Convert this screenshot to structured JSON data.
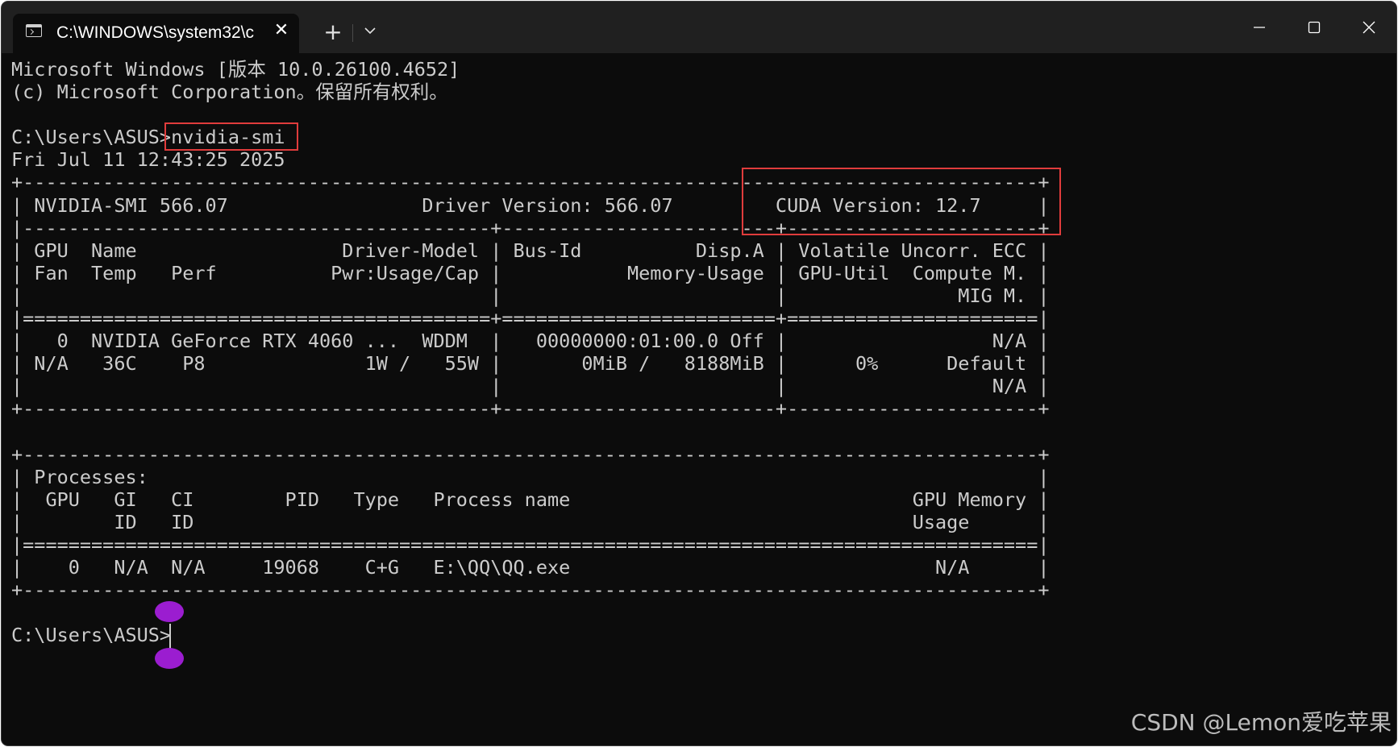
{
  "tab": {
    "title": "C:\\WINDOWS\\system32\\c",
    "close_glyph": "✕",
    "new_tab_glyph": "+"
  },
  "window_controls": {
    "minimize": "minimize-icon",
    "maximize": "maximize-icon",
    "close": "close-icon"
  },
  "terminal": {
    "line1": "Microsoft Windows [版本 10.0.26100.4652]",
    "line2": "(c) Microsoft Corporation。保留所有权利。",
    "prompt1": "C:\\Users\\ASUS>",
    "command1": "nvidia-smi",
    "timestamp": "Fri Jul 11 12:43:25 2025",
    "smi_table": [
      "+-----------------------------------------------------------------------------------------+",
      "| NVIDIA-SMI 566.07                 Driver Version: 566.07         CUDA Version: 12.7     |",
      "|-----------------------------------------+------------------------+----------------------+",
      "| GPU  Name                  Driver-Model | Bus-Id          Disp.A | Volatile Uncorr. ECC |",
      "| Fan  Temp   Perf          Pwr:Usage/Cap |           Memory-Usage | GPU-Util  Compute M. |",
      "|                                         |                        |               MIG M. |",
      "|=========================================+========================+======================|",
      "|   0  NVIDIA GeForce RTX 4060 ...  WDDM  |   00000000:01:00.0 Off |                  N/A |",
      "| N/A   36C    P8              1W /   55W |       0MiB /   8188MiB |      0%      Default |",
      "|                                         |                        |                  N/A |",
      "+-----------------------------------------+------------------------+----------------------+",
      "",
      "+-----------------------------------------------------------------------------------------+",
      "| Processes:                                                                              |",
      "|  GPU   GI   CI        PID   Type   Process name                              GPU Memory |",
      "|        ID   ID                                                               Usage      |",
      "|=========================================================================================|",
      "|    0   N/A  N/A     19068    C+G   E:\\QQ\\QQ.exe                                N/A      |",
      "+-----------------------------------------------------------------------------------------+"
    ],
    "prompt2": "C:\\Users\\ASUS>"
  },
  "watermark": "CSDN @Lemon爱吃苹果",
  "colors": {
    "terminal_bg": "#0c0c0c",
    "titlebar_bg": "#202020",
    "text": "#cccccc",
    "highlight_box": "#e03c3c",
    "cursor_handle": "#9b1dd0"
  }
}
